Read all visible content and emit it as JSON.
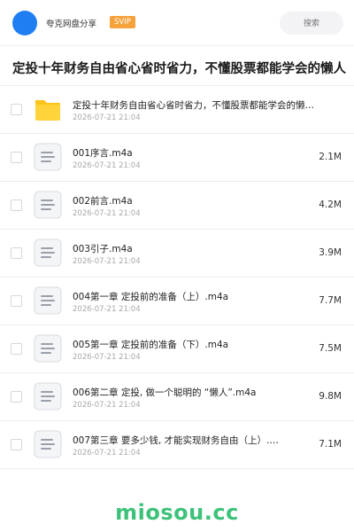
{
  "header": {
    "user_name": "夸克网盘分享",
    "badge": "SVIP",
    "search_placeholder": "搜索"
  },
  "folder_title": "定投十年财务自由省心省时省力，不懂股票都能学会的懒人",
  "files": [
    {
      "name": "定投十年财务自由省心省时省力，不懂股票都能学会的懒…",
      "date": "2026-07-21 21:04",
      "size": "",
      "icon": "folder-icon"
    },
    {
      "name": "001序言.m4a",
      "date": "2026-07-21 21:04",
      "size": "2.1M",
      "icon": "audio-file-icon"
    },
    {
      "name": "002前言.m4a",
      "date": "2026-07-21 21:04",
      "size": "4.2M",
      "icon": "audio-file-icon"
    },
    {
      "name": "003引子.m4a",
      "date": "2026-07-21 21:04",
      "size": "3.9M",
      "icon": "audio-file-icon"
    },
    {
      "name": "004第一章 定投前的准备（上）.m4a",
      "date": "2026-07-21 21:04",
      "size": "7.7M",
      "icon": "audio-file-icon"
    },
    {
      "name": "005第一章 定投前的准备（下）.m4a",
      "date": "2026-07-21 21:04",
      "size": "7.5M",
      "icon": "audio-file-icon"
    },
    {
      "name": "006第二章 定投, 做一个聪明的 “懒人”.m4a",
      "date": "2026-07-21 21:04",
      "size": "9.8M",
      "icon": "audio-file-icon"
    },
    {
      "name": "007第三章 要多少钱, 才能实现财务自由（上）.…",
      "date": "2026-07-21 21:04",
      "size": "7.1M",
      "icon": "audio-file-icon"
    }
  ],
  "watermark": "miosou.cc",
  "colors": {
    "accent": "#1f7ff2",
    "svip": "#f6a23c",
    "folder": "#fcc419",
    "watermark": "#3ec27a"
  }
}
